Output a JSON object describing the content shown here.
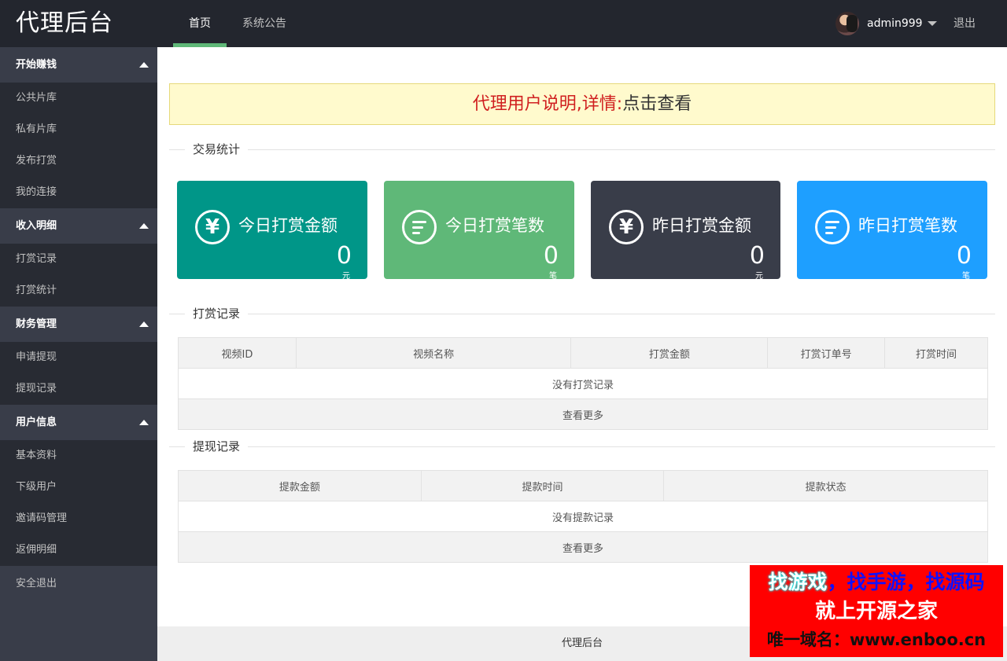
{
  "header": {
    "logo": "代理后台",
    "nav": [
      {
        "label": "首页",
        "active": true
      },
      {
        "label": "系统公告",
        "active": false
      }
    ],
    "username": "admin999",
    "logout_label": "退出"
  },
  "sidebar": {
    "groups": [
      {
        "title": "开始赚钱",
        "items": [
          "公共片库",
          "私有片库",
          "发布打赏",
          "我的连接"
        ]
      },
      {
        "title": "收入明细",
        "items": [
          "打赏记录",
          "打赏统计"
        ]
      },
      {
        "title": "财务管理",
        "items": [
          "申请提现",
          "提现记录"
        ]
      },
      {
        "title": "用户信息",
        "items": [
          "基本资料",
          "下级用户",
          "邀请码管理",
          "返佣明细"
        ]
      }
    ],
    "safe_exit": "安全退出"
  },
  "notice": {
    "text_red": "代理用户说明,详情:",
    "text_link": "点击查看"
  },
  "sections": {
    "stats": "交易统计",
    "rewards": "打赏记录",
    "withdrawals": "提现记录"
  },
  "stats_cards": [
    {
      "title": "今日打赏金额",
      "value": "0",
      "unit": "元",
      "icon": "yen-icon",
      "color": "#009688"
    },
    {
      "title": "今日打赏笔数",
      "value": "0",
      "unit": "笔",
      "icon": "list-icon",
      "color": "#5fb878"
    },
    {
      "title": "昨日打赏金额",
      "value": "0",
      "unit": "元",
      "icon": "yen-icon",
      "color": "#393d49"
    },
    {
      "title": "昨日打赏笔数",
      "value": "0",
      "unit": "笔",
      "icon": "list-icon",
      "color": "#1e9fff"
    }
  ],
  "rewards_table": {
    "headers": [
      "视频ID",
      "视频名称",
      "打赏金额",
      "打赏订单号",
      "打赏时间"
    ],
    "empty": "没有打赏记录",
    "more": "查看更多"
  },
  "withdraw_table": {
    "headers": [
      "提款金额",
      "提款时间",
      "提款状态"
    ],
    "empty": "没有提款记录",
    "more": "查看更多"
  },
  "footer": "代理后台",
  "watermark": {
    "line1_a": "找游戏",
    "line1_b": "，找手游，找源码",
    "line2": "就上开源之家",
    "line3": "唯一域名：www.enboo.cn"
  }
}
